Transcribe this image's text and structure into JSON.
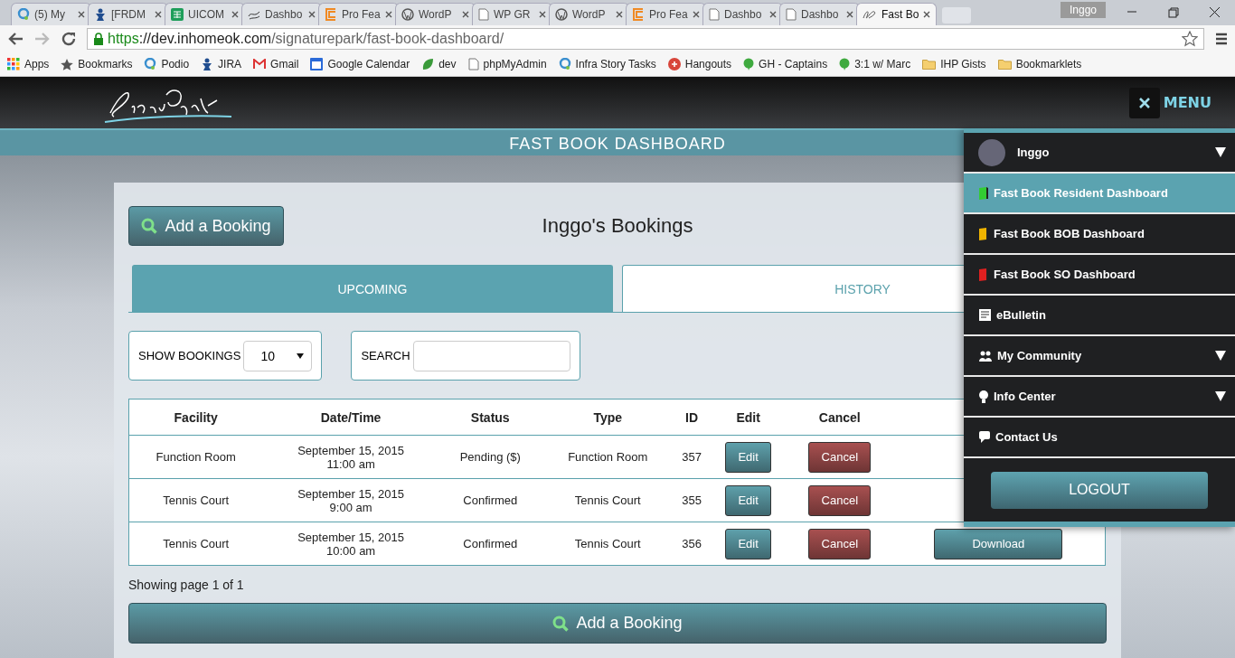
{
  "browser": {
    "tabs": [
      {
        "title": "(5) My",
        "selected": false,
        "kind": "podio"
      },
      {
        "title": "[FRDM",
        "selected": false,
        "kind": "jira"
      },
      {
        "title": "UICOM",
        "selected": false,
        "kind": "sheet"
      },
      {
        "title": "Dashbo",
        "selected": false,
        "kind": "logo"
      },
      {
        "title": "Pro Fea",
        "selected": false,
        "kind": "pro"
      },
      {
        "title": "WordP",
        "selected": false,
        "kind": "wp"
      },
      {
        "title": "WP GR",
        "selected": false,
        "kind": "page"
      },
      {
        "title": "WordP",
        "selected": false,
        "kind": "wp"
      },
      {
        "title": "Pro Fea",
        "selected": false,
        "kind": "pro"
      },
      {
        "title": "Dashbo",
        "selected": false,
        "kind": "page"
      },
      {
        "title": "Dashbo",
        "selected": false,
        "kind": "page"
      },
      {
        "title": "Fast Bo",
        "selected": true,
        "kind": "sp"
      }
    ],
    "profile": "Inggo",
    "url_scheme": "https",
    "url_host": "://dev.inhomeok.com",
    "url_path": "/signaturepark/fast-book-dashboard/",
    "bookmarks": [
      {
        "label": "Apps",
        "kind": "apps"
      },
      {
        "label": "Bookmarks",
        "kind": "star"
      },
      {
        "label": "Podio",
        "kind": "podio"
      },
      {
        "label": "JIRA",
        "kind": "jira"
      },
      {
        "label": "Gmail",
        "kind": "gmail"
      },
      {
        "label": "Google Calendar",
        "kind": "calendar"
      },
      {
        "label": "dev",
        "kind": "leaf"
      },
      {
        "label": "phpMyAdmin",
        "kind": "page"
      },
      {
        "label": "Infra Story Tasks",
        "kind": "podio"
      },
      {
        "label": "Hangouts",
        "kind": "gplus"
      },
      {
        "label": "GH - Captains",
        "kind": "bubble"
      },
      {
        "label": "3:1 w/ Marc",
        "kind": "bubble"
      },
      {
        "label": "IHP Gists",
        "kind": "folder"
      },
      {
        "label": "Bookmarklets",
        "kind": "folder"
      }
    ]
  },
  "site": {
    "menu_label": "MENU",
    "page_title": "FAST BOOK DASHBOARD"
  },
  "card": {
    "add_button": "Add a Booking",
    "heading": "Inggo's Bookings",
    "tabs": [
      {
        "label": "UPCOMING",
        "selected": true
      },
      {
        "label": "HISTORY",
        "selected": false
      }
    ],
    "show_label": "SHOW BOOKINGS",
    "show_value": "10",
    "search_label": "SEARCH",
    "table": {
      "columns": [
        "Facility",
        "Date/Time",
        "Status",
        "Type",
        "ID",
        "Edit",
        "Cancel",
        ""
      ],
      "rows": [
        {
          "facility": "Function Room",
          "date": "September 15, 2015",
          "time": "11:00 am",
          "status": "Pending ($)",
          "type": "Function Room",
          "id": "357",
          "edit": "Edit",
          "cancel": "Cancel"
        },
        {
          "facility": "Tennis Court",
          "date": "September 15, 2015",
          "time": "9:00 am",
          "status": "Confirmed",
          "type": "Tennis Court",
          "id": "355",
          "edit": "Edit",
          "cancel": "Cancel"
        },
        {
          "facility": "Tennis Court",
          "date": "September 15, 2015",
          "time": "10:00 am",
          "status": "Confirmed",
          "type": "Tennis Court",
          "id": "356",
          "edit": "Edit",
          "cancel": "Cancel",
          "download": "Download"
        }
      ]
    },
    "page_info": "Showing page 1 of 1",
    "bottom_button": "Add a Booking"
  },
  "menu": {
    "user": {
      "name": "Inggo",
      "expanded": false
    },
    "items": [
      {
        "label": "Fast Book Resident Dashboard",
        "kind": "book",
        "color": "#33cc33",
        "selected": true,
        "submenu": false
      },
      {
        "label": "Fast Book BOB Dashboard",
        "kind": "book",
        "color": "#f0b400",
        "selected": false,
        "submenu": false
      },
      {
        "label": "Fast Book SO Dashboard",
        "kind": "book",
        "color": "#e02020",
        "selected": false,
        "submenu": false
      },
      {
        "label": "eBulletin",
        "kind": "bulletin",
        "selected": false,
        "submenu": false
      },
      {
        "label": "My Community",
        "kind": "people",
        "selected": false,
        "submenu": true
      },
      {
        "label": "Info Center",
        "kind": "bulb",
        "selected": false,
        "submenu": true
      },
      {
        "label": "Contact Us",
        "kind": "chat",
        "selected": false,
        "submenu": false
      }
    ],
    "logout": "LOGOUT"
  }
}
